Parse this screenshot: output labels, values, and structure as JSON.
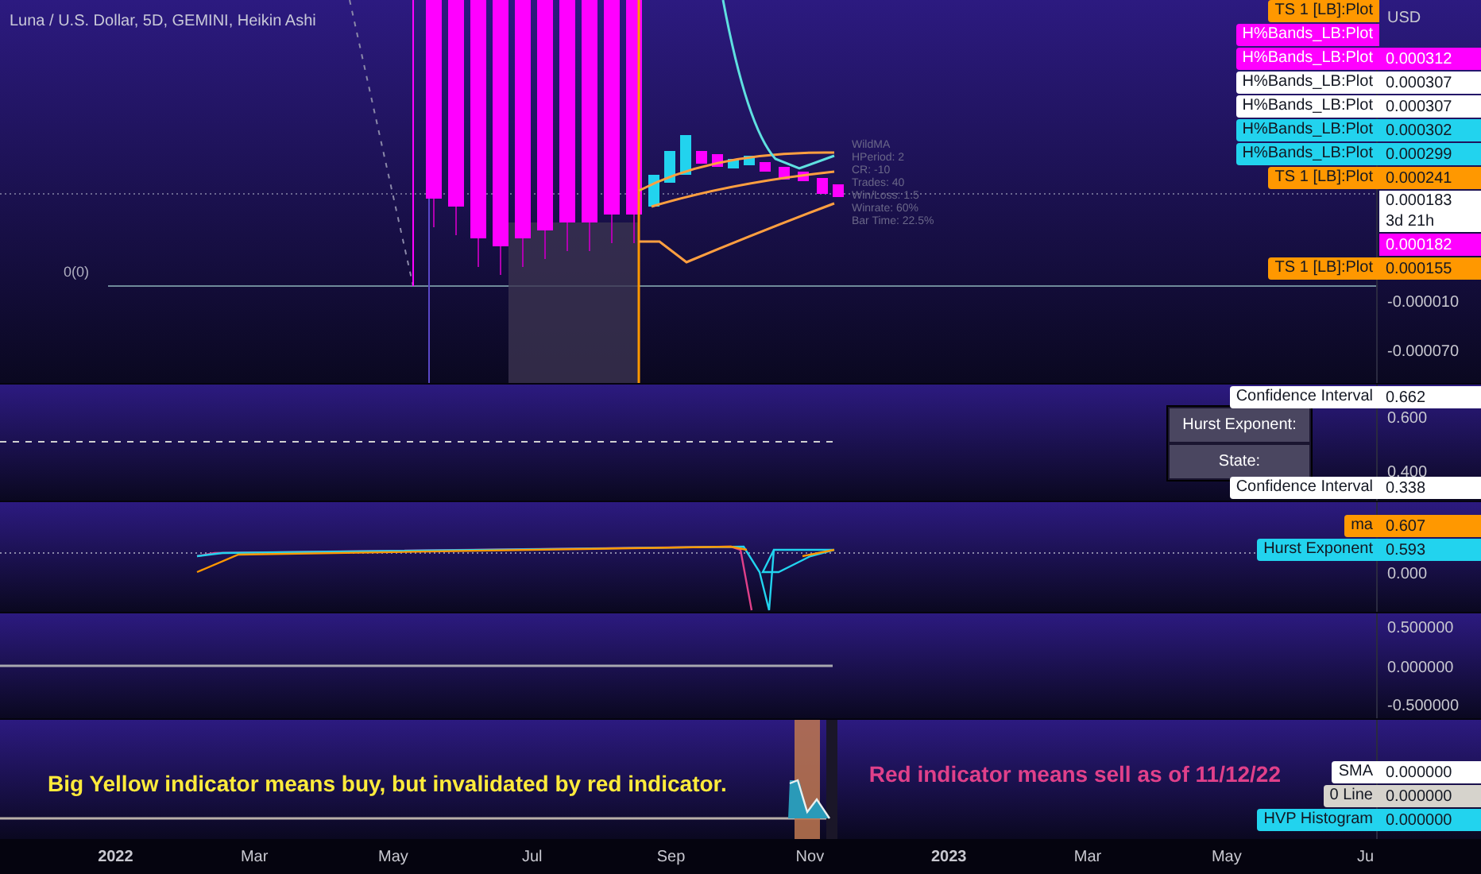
{
  "chart_title": "Luna / U.S. Dollar, 5D, GEMINI, Heikin Ashi",
  "main_pane": {
    "currency": "USD",
    "zero_label": "0(0)",
    "strategy_stats": [
      "WildMA",
      "HPeriod: 2",
      "CR: -10",
      "Trades: 40",
      "Win/Loss: 1.5",
      "Winrate: 60%",
      "Bar Time: 22.5%"
    ],
    "price_labels": [
      {
        "label": "TS 1 [LB]:Plot",
        "color": "#ff9800"
      },
      {
        "label": "H%Bands_LB:Plot",
        "color": "#ff00ff"
      },
      {
        "label": "H%Bands_LB:Plot",
        "value": "0.000312",
        "color": "#ff00ff"
      },
      {
        "label": "H%Bands_LB:Plot",
        "value": "0.000307",
        "color": "#ffffff"
      },
      {
        "label": "H%Bands_LB:Plot",
        "value": "0.000307",
        "color": "#ffffff"
      },
      {
        "label": "H%Bands_LB:Plot",
        "value": "0.000302",
        "color": "#22d3ee"
      },
      {
        "label": "H%Bands_LB:Plot",
        "value": "0.000299",
        "color": "#22d3ee"
      },
      {
        "label": "TS 1 [LB]:Plot",
        "value": "0.000241",
        "color": "#ff9800"
      },
      {
        "value": "0.000183",
        "countdown": "3d 21h",
        "color": "#ffffff"
      },
      {
        "value": "0.000182",
        "color": "#ff00ff"
      },
      {
        "label": "TS 1 [LB]:Plot",
        "value": "0.000155",
        "color": "#ff9800"
      }
    ],
    "axis_ticks": [
      "-0.000010",
      "-0.000070"
    ]
  },
  "hurst_pane": {
    "top_label": {
      "label": "Confidence Interval",
      "value": "0.662",
      "color": "#ffffff"
    },
    "bottom_label": {
      "label": "Confidence Interval",
      "value": "0.338",
      "color": "#ffffff"
    },
    "table": [
      "Hurst Exponent:",
      "State:"
    ],
    "axis_ticks": [
      "0.600",
      "0.400"
    ]
  },
  "ma_pane": {
    "labels": [
      {
        "label": "ma",
        "value": "0.607",
        "color": "#ff9800"
      },
      {
        "label": "Hurst Exponent",
        "value": "0.593",
        "color": "#22d3ee"
      }
    ],
    "axis_ticks": [
      "0.000"
    ]
  },
  "oscillator_pane": {
    "axis_ticks": [
      "0.500000",
      "0.000000",
      "-0.500000"
    ]
  },
  "hvp_pane": {
    "notes": [
      {
        "text": "Big Yellow indicator means buy, but invalidated by red indicator.",
        "color": "#ffeb3b"
      },
      {
        "text": "Red indicator means sell as of 11/12/22",
        "color": "#e0408a"
      }
    ],
    "labels": [
      {
        "label": "SMA",
        "value": "0.000000",
        "color": "#ffffff"
      },
      {
        "label": "0 Line",
        "value": "0.000000",
        "color": "#d6d3cc"
      },
      {
        "label": "HVP Histogram",
        "value": "0.000000",
        "color": "#22d3ee"
      }
    ]
  },
  "time_axis": [
    "2022",
    "Mar",
    "May",
    "Jul",
    "Sep",
    "Nov",
    "2023",
    "Mar",
    "May",
    "Ju"
  ]
}
